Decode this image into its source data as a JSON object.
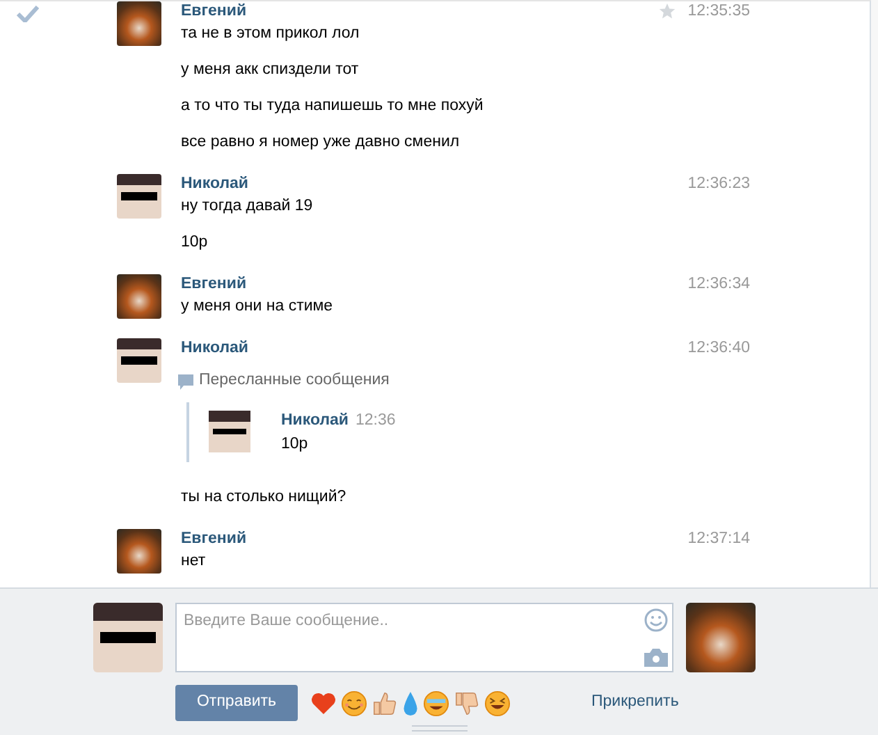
{
  "messages": [
    {
      "author": "Евгений",
      "time": "12:35:35",
      "avatar": {
        "kind": "fox"
      },
      "hovered": true,
      "lines": [
        "та не в этом прикол лол",
        "у меня акк спиздели тот",
        "а то что ты туда напишешь то мне похуй",
        "все равно я номер уже давно сменил"
      ]
    },
    {
      "author": "Николай",
      "time": "12:36:23",
      "avatar": {
        "kind": "glasses"
      },
      "hovered": false,
      "lines": [
        "ну тогда давай 19",
        "10р"
      ]
    },
    {
      "author": "Евгений",
      "time": "12:36:34",
      "avatar": {
        "kind": "fox"
      },
      "hovered": false,
      "lines": [
        "у меня они на стиме"
      ]
    },
    {
      "author": "Николай",
      "time": "12:36:40",
      "avatar": {
        "kind": "glasses"
      },
      "hovered": false,
      "forwarded": {
        "label": "Пересланные сообщения",
        "messages": [
          {
            "author": "Николай",
            "time": "12:36",
            "avatar": {
              "kind": "glasses"
            },
            "lines": [
              "10р"
            ]
          }
        ]
      },
      "lines_after": [
        "ты на столько нищий?"
      ]
    },
    {
      "author": "Евгений",
      "time": "12:37:14",
      "avatar": {
        "kind": "fox"
      },
      "hovered": false,
      "lines": [
        "нет"
      ]
    }
  ],
  "composer": {
    "own_avatar": {
      "kind": "glasses"
    },
    "placeholder": "Введите Ваше сообщение..",
    "partner_avatar": {
      "kind": "fox"
    },
    "send": "Отправить",
    "emojis": [
      {
        "kind": "heart"
      },
      {
        "kind": "smile"
      },
      {
        "kind": "thumbs-up"
      },
      {
        "kind": "droplet"
      },
      {
        "kind": "tears"
      },
      {
        "kind": "thumbs-down"
      },
      {
        "kind": "laugh"
      }
    ],
    "attach": "Прикрепить"
  }
}
